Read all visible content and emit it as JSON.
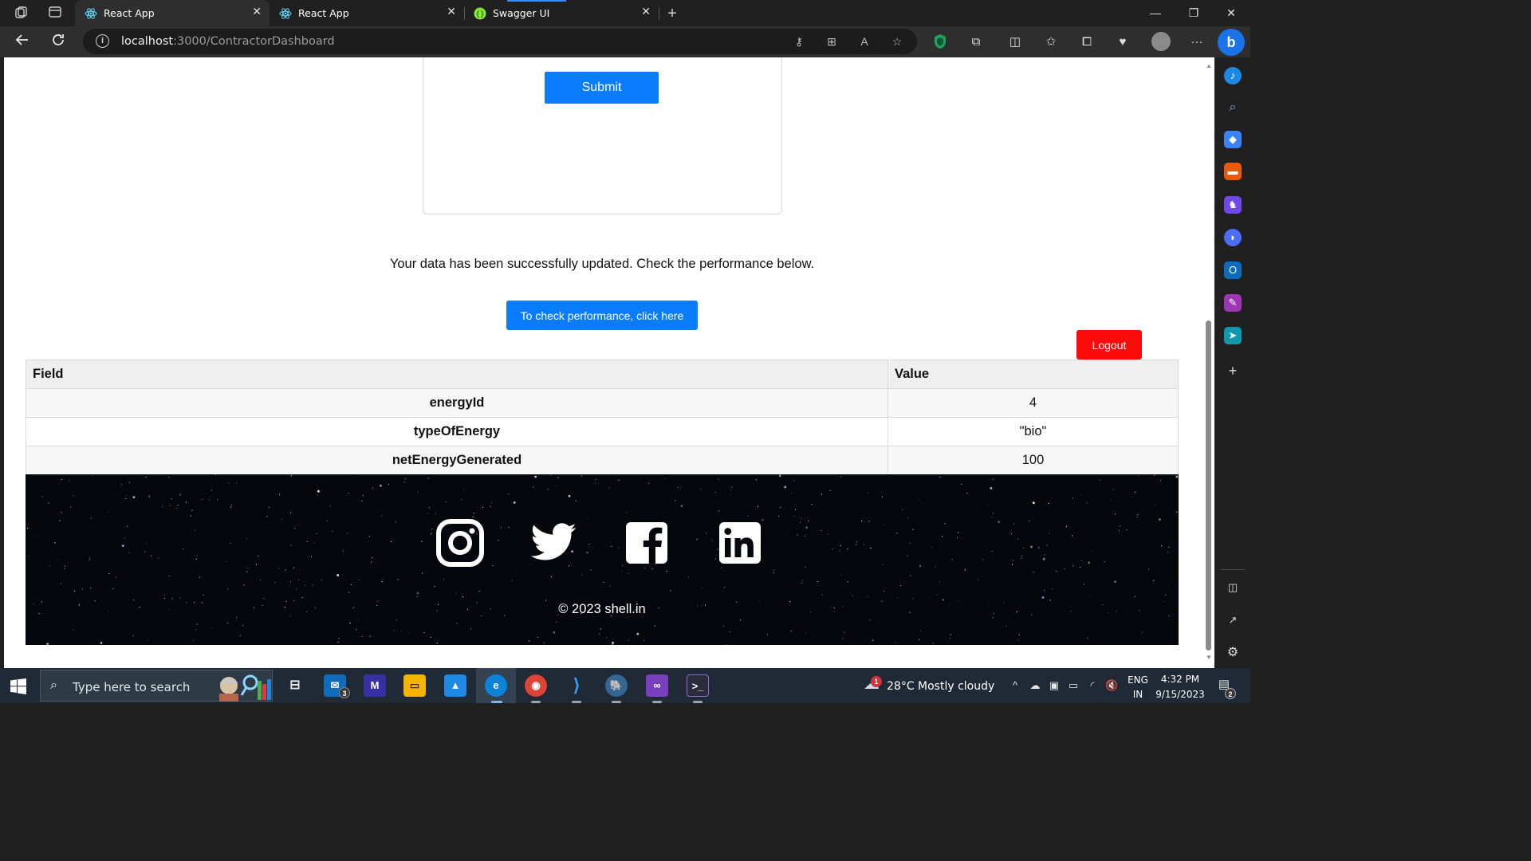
{
  "browser": {
    "tabs": [
      {
        "label": "React App",
        "active": true
      },
      {
        "label": "React App",
        "active": false
      },
      {
        "label": "Swagger UI",
        "active": false
      }
    ],
    "url_host": "localhost",
    "url_path": ":3000/ContractorDashboard"
  },
  "page": {
    "submit_label": "Submit",
    "success_message": "Your data has been successfully updated. Check the performance below.",
    "performance_button": "To check performance, click here",
    "logout_button": "Logout",
    "table": {
      "headers": [
        "Field",
        "Value"
      ],
      "rows": [
        {
          "field": "energyId",
          "value": "4"
        },
        {
          "field": "typeOfEnergy",
          "value": "\"bio\""
        },
        {
          "field": "netEnergyGenerated",
          "value": "100"
        }
      ]
    },
    "footer": {
      "social_icons": [
        "instagram-icon",
        "twitter-icon",
        "facebook-icon",
        "linkedin-icon"
      ],
      "copyright": "© 2023 shell.in"
    }
  },
  "taskbar": {
    "search_placeholder": "Type here to search",
    "mail_badge": "3",
    "weather_badge": "1",
    "weather": "28°C  Mostly cloudy",
    "lang_top": "ENG",
    "lang_bottom": "IN",
    "time": "4:32 PM",
    "date": "9/15/2023",
    "notification_count": "2"
  },
  "colors": {
    "primary_button": "#0a7cff",
    "logout_button": "#ff0a0a",
    "footer_bg": "#05070c"
  }
}
